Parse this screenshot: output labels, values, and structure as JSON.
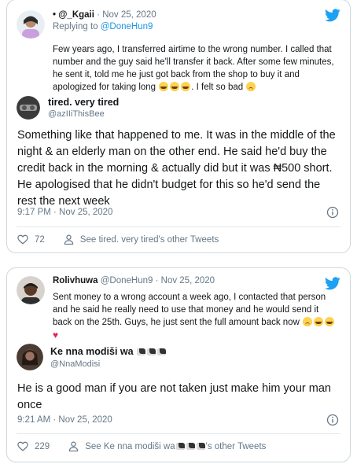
{
  "colors": {
    "accent": "#1da1f2",
    "link": "#1b95e0",
    "muted": "#657786",
    "text": "#14171a",
    "border": "#cfd9de",
    "heart": "#e0245e"
  },
  "card1": {
    "reply": {
      "name": "• @_Kgaii",
      "handle": "",
      "separator": "·",
      "date": "Nov 25, 2020",
      "replying_prefix": "Replying to ",
      "replying_handle": "@DoneHun9",
      "text": "Few years ago, I transferred airtime to the wrong number. I called that number and the guy said he'll transfer it back. After some few minutes, he sent it, told me he just got back from the shop to buy it and apologized for taking long",
      "text_tail": ". I felt so bad",
      "emojis": [
        "crying-face",
        "crying-face",
        "crying-face",
        "sad-face"
      ]
    },
    "quoted": {
      "name": "tired. very tired",
      "handle": "@azIIiThisBee"
    },
    "main_text": "Something like that happened to me. It was in the middle of the night & an elderly man on the other end. He said he'd buy the credit back in the morning & actually did but it was ₦500 short. He apologised that he didn't budget for this so he'd send the rest the next week",
    "timestamp": "9:17 PM · Nov 25, 2020",
    "likes": "72",
    "see_other": "See tired. very tired's other Tweets"
  },
  "card2": {
    "reply": {
      "name": "Rolivhuwa",
      "handle": "@DoneHun9",
      "separator": "·",
      "date": "Nov 25, 2020",
      "text": "Sent money to a wrong account a week ago, I contacted that person and he said he really need to use that money and he would send it back on the 25th. Guys, he just sent the full amount back now",
      "emojis": [
        "smiling-face",
        "crying-face",
        "crying-face",
        "red-heart"
      ]
    },
    "quoted": {
      "name": "Ke nna modiši wa",
      "handle": "@NnaModisi",
      "name_emojis": [
        "cow-face",
        "cow-face",
        "cow-face"
      ]
    },
    "main_text": "He is a good man if you are not taken just make him your man once",
    "timestamp": "9:21 AM · Nov 25, 2020",
    "likes": "229",
    "see_other_prefix": "See Ke nna modiši wa",
    "see_other_suffix": "'s other Tweets"
  }
}
